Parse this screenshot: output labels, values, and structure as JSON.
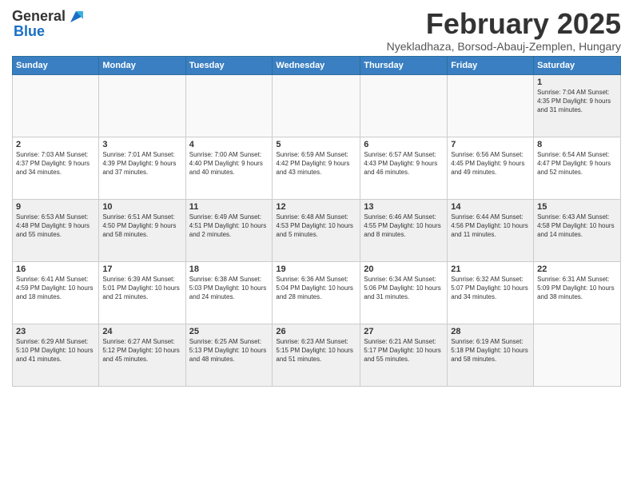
{
  "header": {
    "logo_general": "General",
    "logo_blue": "Blue",
    "month_title": "February 2025",
    "location": "Nyekladhaza, Borsod-Abauj-Zemplen, Hungary"
  },
  "weekdays": [
    "Sunday",
    "Monday",
    "Tuesday",
    "Wednesday",
    "Thursday",
    "Friday",
    "Saturday"
  ],
  "weeks": [
    [
      {
        "day": "",
        "info": "",
        "empty": true
      },
      {
        "day": "",
        "info": "",
        "empty": true
      },
      {
        "day": "",
        "info": "",
        "empty": true
      },
      {
        "day": "",
        "info": "",
        "empty": true
      },
      {
        "day": "",
        "info": "",
        "empty": true
      },
      {
        "day": "",
        "info": "",
        "empty": true
      },
      {
        "day": "1",
        "info": "Sunrise: 7:04 AM\nSunset: 4:35 PM\nDaylight: 9 hours and 31 minutes."
      }
    ],
    [
      {
        "day": "2",
        "info": "Sunrise: 7:03 AM\nSunset: 4:37 PM\nDaylight: 9 hours and 34 minutes."
      },
      {
        "day": "3",
        "info": "Sunrise: 7:01 AM\nSunset: 4:39 PM\nDaylight: 9 hours and 37 minutes."
      },
      {
        "day": "4",
        "info": "Sunrise: 7:00 AM\nSunset: 4:40 PM\nDaylight: 9 hours and 40 minutes."
      },
      {
        "day": "5",
        "info": "Sunrise: 6:59 AM\nSunset: 4:42 PM\nDaylight: 9 hours and 43 minutes."
      },
      {
        "day": "6",
        "info": "Sunrise: 6:57 AM\nSunset: 4:43 PM\nDaylight: 9 hours and 46 minutes."
      },
      {
        "day": "7",
        "info": "Sunrise: 6:56 AM\nSunset: 4:45 PM\nDaylight: 9 hours and 49 minutes."
      },
      {
        "day": "8",
        "info": "Sunrise: 6:54 AM\nSunset: 4:47 PM\nDaylight: 9 hours and 52 minutes."
      }
    ],
    [
      {
        "day": "9",
        "info": "Sunrise: 6:53 AM\nSunset: 4:48 PM\nDaylight: 9 hours and 55 minutes."
      },
      {
        "day": "10",
        "info": "Sunrise: 6:51 AM\nSunset: 4:50 PM\nDaylight: 9 hours and 58 minutes."
      },
      {
        "day": "11",
        "info": "Sunrise: 6:49 AM\nSunset: 4:51 PM\nDaylight: 10 hours and 2 minutes."
      },
      {
        "day": "12",
        "info": "Sunrise: 6:48 AM\nSunset: 4:53 PM\nDaylight: 10 hours and 5 minutes."
      },
      {
        "day": "13",
        "info": "Sunrise: 6:46 AM\nSunset: 4:55 PM\nDaylight: 10 hours and 8 minutes."
      },
      {
        "day": "14",
        "info": "Sunrise: 6:44 AM\nSunset: 4:56 PM\nDaylight: 10 hours and 11 minutes."
      },
      {
        "day": "15",
        "info": "Sunrise: 6:43 AM\nSunset: 4:58 PM\nDaylight: 10 hours and 14 minutes."
      }
    ],
    [
      {
        "day": "16",
        "info": "Sunrise: 6:41 AM\nSunset: 4:59 PM\nDaylight: 10 hours and 18 minutes."
      },
      {
        "day": "17",
        "info": "Sunrise: 6:39 AM\nSunset: 5:01 PM\nDaylight: 10 hours and 21 minutes."
      },
      {
        "day": "18",
        "info": "Sunrise: 6:38 AM\nSunset: 5:03 PM\nDaylight: 10 hours and 24 minutes."
      },
      {
        "day": "19",
        "info": "Sunrise: 6:36 AM\nSunset: 5:04 PM\nDaylight: 10 hours and 28 minutes."
      },
      {
        "day": "20",
        "info": "Sunrise: 6:34 AM\nSunset: 5:06 PM\nDaylight: 10 hours and 31 minutes."
      },
      {
        "day": "21",
        "info": "Sunrise: 6:32 AM\nSunset: 5:07 PM\nDaylight: 10 hours and 34 minutes."
      },
      {
        "day": "22",
        "info": "Sunrise: 6:31 AM\nSunset: 5:09 PM\nDaylight: 10 hours and 38 minutes."
      }
    ],
    [
      {
        "day": "23",
        "info": "Sunrise: 6:29 AM\nSunset: 5:10 PM\nDaylight: 10 hours and 41 minutes."
      },
      {
        "day": "24",
        "info": "Sunrise: 6:27 AM\nSunset: 5:12 PM\nDaylight: 10 hours and 45 minutes."
      },
      {
        "day": "25",
        "info": "Sunrise: 6:25 AM\nSunset: 5:13 PM\nDaylight: 10 hours and 48 minutes."
      },
      {
        "day": "26",
        "info": "Sunrise: 6:23 AM\nSunset: 5:15 PM\nDaylight: 10 hours and 51 minutes."
      },
      {
        "day": "27",
        "info": "Sunrise: 6:21 AM\nSunset: 5:17 PM\nDaylight: 10 hours and 55 minutes."
      },
      {
        "day": "28",
        "info": "Sunrise: 6:19 AM\nSunset: 5:18 PM\nDaylight: 10 hours and 58 minutes."
      },
      {
        "day": "",
        "info": "",
        "empty": true
      }
    ]
  ]
}
